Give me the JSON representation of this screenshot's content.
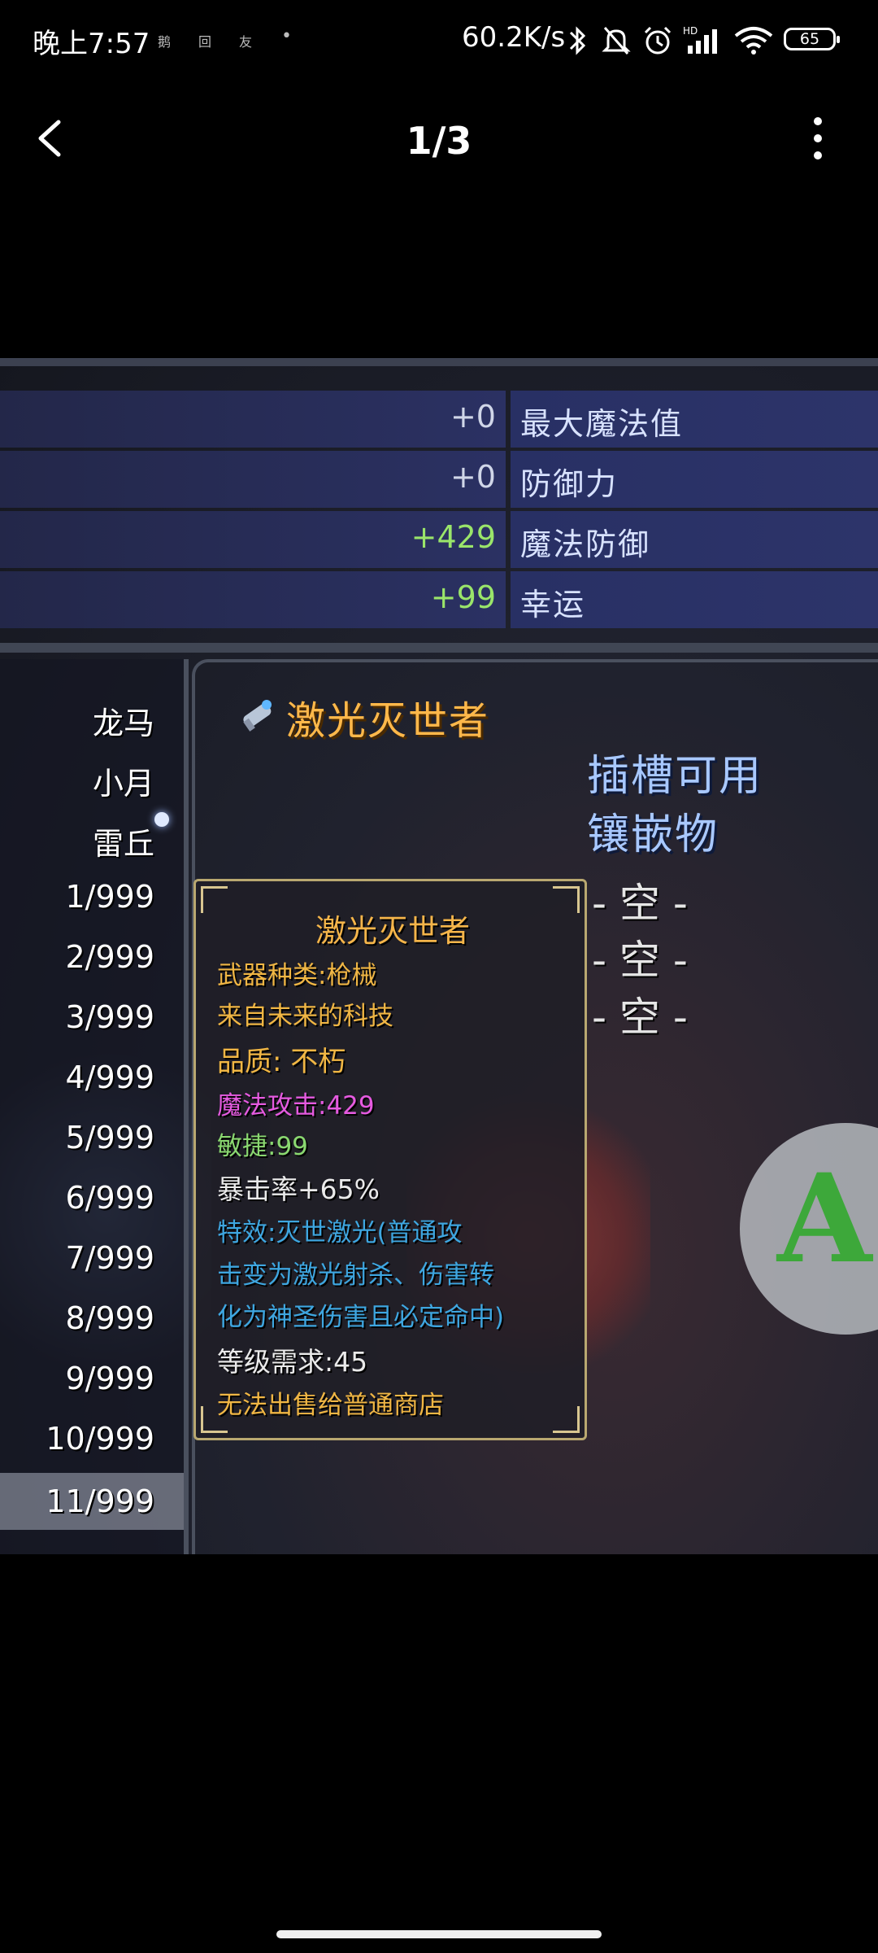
{
  "status_bar": {
    "time": "晚上7:57",
    "mini_icons": [
      "鹅",
      "回",
      "友",
      "•"
    ],
    "net_speed": "60.2K/s",
    "icons": [
      "bluetooth-icon",
      "mute-bell-icon",
      "alarm-icon",
      "signal-icon",
      "wifi-icon"
    ],
    "battery": "65"
  },
  "nav": {
    "counter": "1/3",
    "back_icon": "back-arrow-icon",
    "more_icon": "more-vertical-icon"
  },
  "stats": [
    {
      "value": "+0",
      "label": "最大魔法值",
      "color": "white"
    },
    {
      "value": "+0",
      "label": "防御力",
      "color": "white"
    },
    {
      "value": "+429",
      "label": "魔法防御",
      "color": "green"
    },
    {
      "value": "+99",
      "label": "幸运",
      "color": "green"
    }
  ],
  "left_list": [
    "龙马",
    "小月",
    "雷丘",
    "1/999",
    "2/999",
    "3/999",
    "4/999",
    "5/999",
    "6/999",
    "7/999",
    "8/999",
    "9/999",
    "10/999",
    "11/999"
  ],
  "item": {
    "name": "激光灭世者",
    "slot_title_line1": "插槽可用",
    "slot_title_line2": "镶嵌物",
    "slots": [
      "- 空 -",
      "- 空 -",
      "- 空 -"
    ]
  },
  "tooltip": {
    "title": "激光灭世者",
    "lines": [
      {
        "text": "武器种类:枪械",
        "color": "orange"
      },
      {
        "text": "来自未来的科技",
        "color": "orange"
      },
      {
        "text": "品质: 不朽",
        "color": "orange"
      },
      {
        "text": "魔法攻击:429",
        "color": "magenta"
      },
      {
        "text": "敏捷:99",
        "color": "green"
      },
      {
        "text": "暴击率+65%",
        "color": "white"
      },
      {
        "text": "特效:灭世激光(普通攻",
        "color": "blue"
      },
      {
        "text": "击变为激光射杀、伤害转",
        "color": "blue"
      },
      {
        "text": "化为神圣伤害且必定命中)",
        "color": "blue"
      },
      {
        "text": "等级需求:45",
        "color": "white"
      },
      {
        "text": "无法出售给普通商店",
        "color": "orange"
      }
    ]
  },
  "action_button": {
    "label": "A"
  },
  "colors": {
    "item_name": "#ffb84a",
    "slot_title": "#a8c8ff",
    "green_value": "#9ae56a",
    "effect_blue": "#3ea6e0"
  }
}
